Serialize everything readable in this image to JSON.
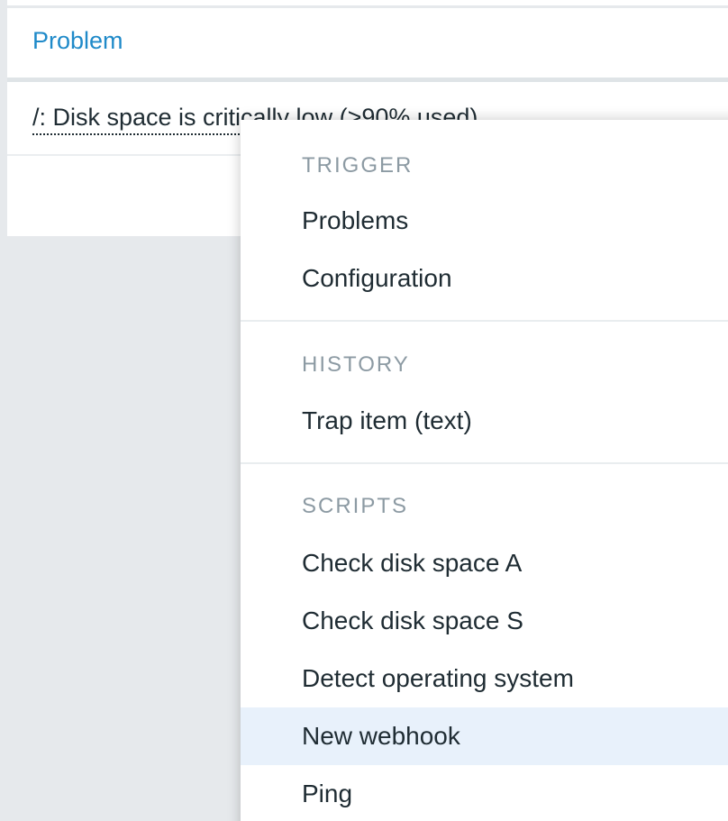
{
  "table": {
    "header_label": "Problem",
    "problem_text": "/: Disk space is critically low (>90% used)"
  },
  "context_menu": {
    "sections": [
      {
        "title": "TRIGGER",
        "items": [
          {
            "label": "Problems"
          },
          {
            "label": "Configuration"
          }
        ]
      },
      {
        "title": "HISTORY",
        "items": [
          {
            "label": "Trap item (text)"
          }
        ]
      },
      {
        "title": "SCRIPTS",
        "items": [
          {
            "label": "Check disk space A"
          },
          {
            "label": "Check disk space S"
          },
          {
            "label": "Detect operating system"
          },
          {
            "label": "New webhook",
            "highlighted": true
          },
          {
            "label": "Ping"
          }
        ]
      }
    ]
  },
  "colors": {
    "link": "#1f8ac9",
    "text": "#1f2c33",
    "section_header": "#8c9aa3",
    "hover_background": "#e8f1fb",
    "page_background": "#e6e9ec"
  }
}
